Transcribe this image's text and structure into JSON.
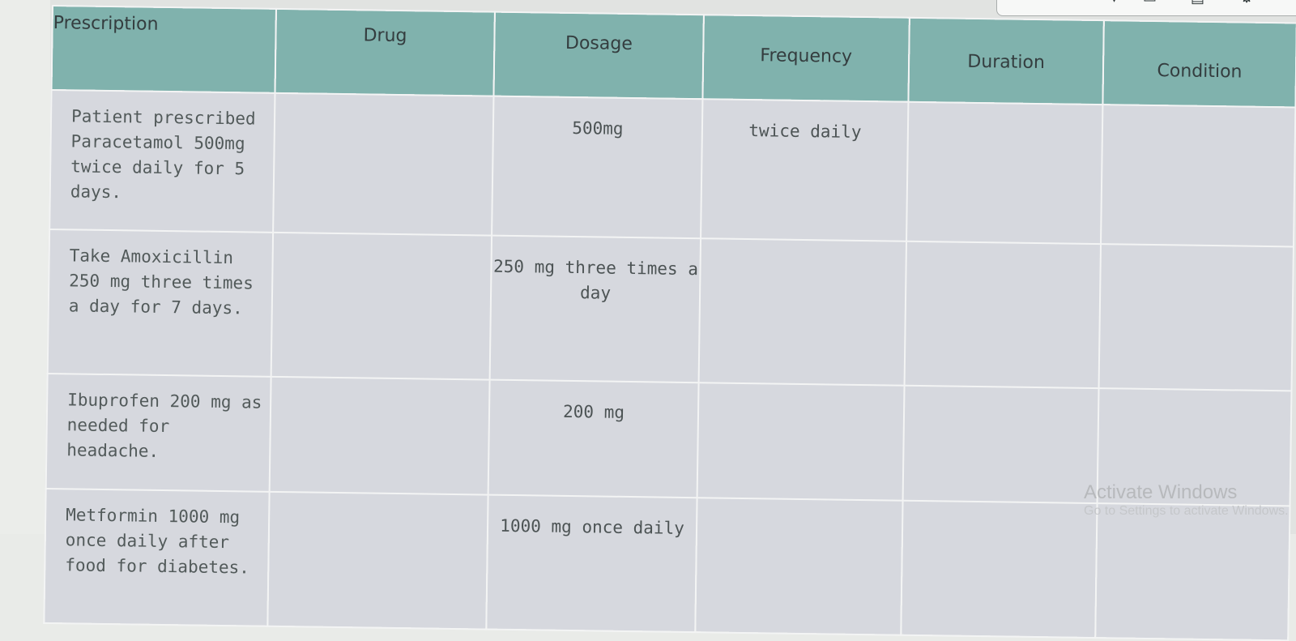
{
  "table": {
    "headers": [
      "Prescription",
      "Drug",
      "Dosage",
      "Frequency",
      "Duration",
      "Condition"
    ],
    "rows": [
      {
        "prescription": "Patient prescribed Paracetamol 500mg twice daily for 5 days.",
        "drug": "",
        "dosage": "500mg",
        "frequency": "twice daily",
        "duration": "",
        "condition": ""
      },
      {
        "prescription": "Take Amoxicillin 250 mg three times a day for 7 days.",
        "drug": "",
        "dosage": "250 mg three times a day",
        "frequency": "",
        "duration": "",
        "condition": ""
      },
      {
        "prescription": "Ibuprofen 200 mg as needed for headache.",
        "drug": "",
        "dosage": "200 mg",
        "frequency": "",
        "duration": "",
        "condition": ""
      },
      {
        "prescription": "Metformin 1000 mg once daily after food for diabetes.",
        "drug": "",
        "dosage": "1000 mg once daily",
        "frequency": "",
        "duration": "",
        "condition": ""
      }
    ]
  },
  "system": {
    "watermark_title": "Activate Windows",
    "watermark_subtitle": "Go to Settings to activate Windows."
  },
  "icons": [
    "dropdown-icon",
    "page-icon",
    "gear-icon"
  ]
}
